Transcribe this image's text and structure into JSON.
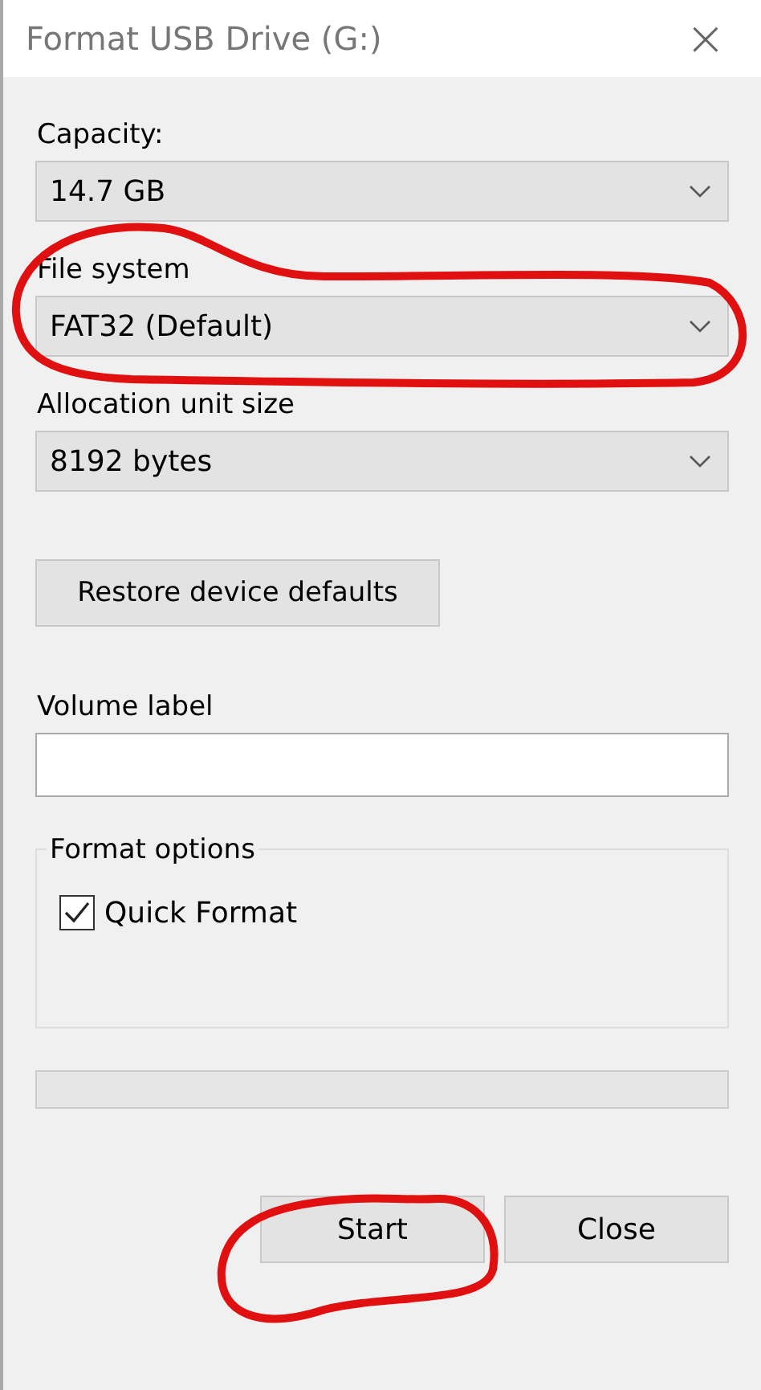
{
  "window": {
    "title": "Format USB Drive (G:)",
    "close_glyph": "×"
  },
  "fields": [
    {
      "kind": "dropdown",
      "label": "Capacity:",
      "value": "14.7 GB"
    },
    {
      "kind": "dropdown",
      "label": "File system",
      "value": "FAT32 (Default)"
    },
    {
      "kind": "dropdown",
      "label": "Allocation unit size",
      "value": "8192 bytes"
    }
  ],
  "restore_button": "Restore device defaults",
  "volume_label": {
    "label": "Volume label"
  },
  "format_options": {
    "title": "Format options",
    "options": [
      {
        "label": "Quick Format",
        "checked": true
      }
    ]
  },
  "buttons": [
    {
      "label": "Start"
    },
    {
      "label": "Close"
    }
  ]
}
